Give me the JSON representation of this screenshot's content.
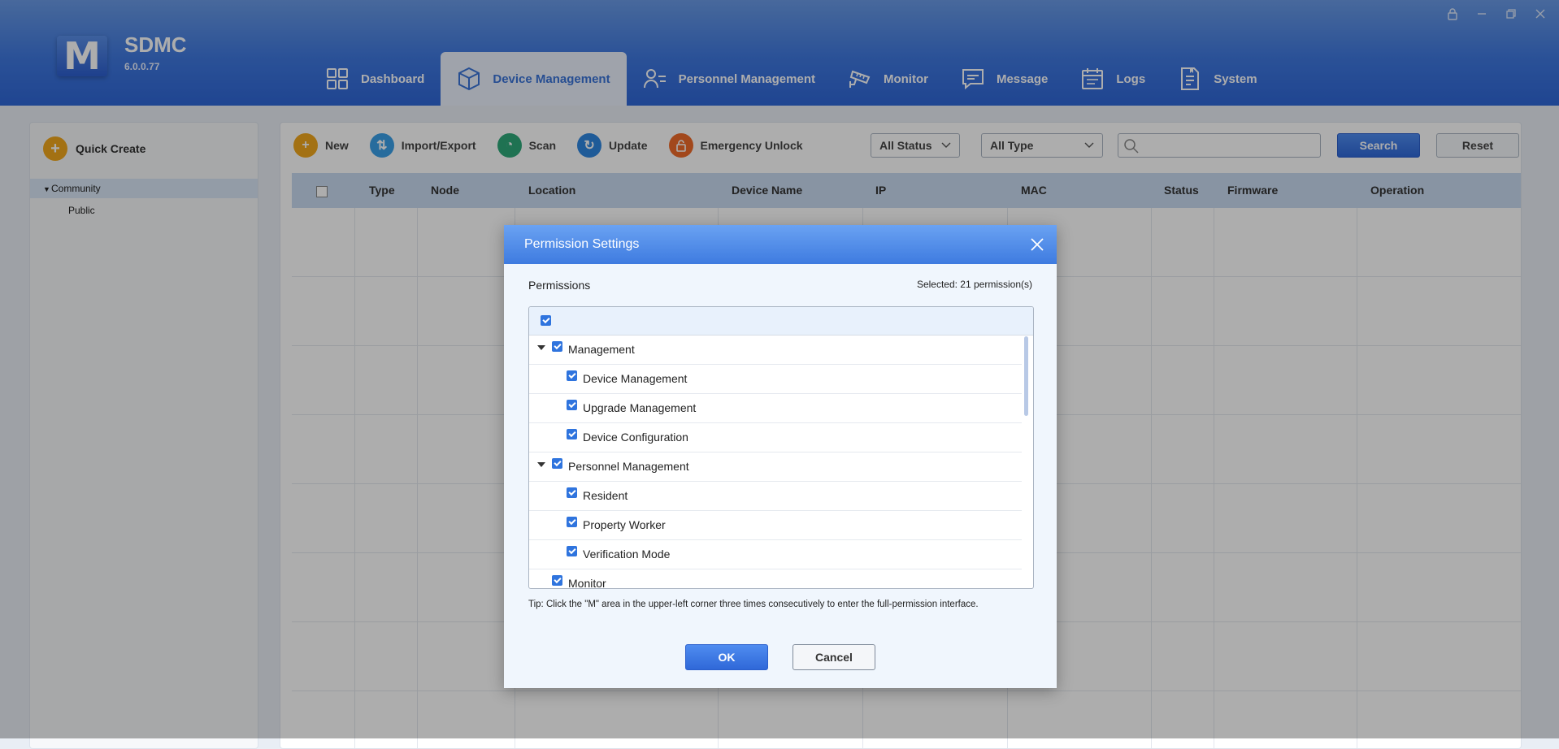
{
  "app": {
    "logo_letter": "M",
    "name": "SDMC",
    "version": "6.0.0.77"
  },
  "window_controls": [
    "lock-icon",
    "minimize-icon",
    "restore-icon",
    "close-icon"
  ],
  "nav": [
    {
      "label": "Dashboard",
      "icon": "dashboard-icon"
    },
    {
      "label": "Device Management",
      "icon": "device-box-icon",
      "active": true
    },
    {
      "label": "Personnel Management",
      "icon": "person-list-icon"
    },
    {
      "label": "Monitor",
      "icon": "camera-icon"
    },
    {
      "label": "Message",
      "icon": "message-icon"
    },
    {
      "label": "Logs",
      "icon": "calendar-icon"
    },
    {
      "label": "System",
      "icon": "document-icon"
    }
  ],
  "sidebar": {
    "quick_create": "Quick Create",
    "tree": {
      "root": "Community",
      "child": "Public"
    }
  },
  "toolbar": {
    "new": "New",
    "import_export": "Import/Export",
    "scan": "Scan",
    "update": "Update",
    "emergency_unlock": "Emergency Unlock",
    "status_select": "All Status",
    "type_select": "All Type",
    "search_placeholder": "",
    "search_button": "Search",
    "reset_button": "Reset"
  },
  "table": {
    "columns": [
      "Type",
      "Node",
      "Location",
      "Device Name",
      "IP",
      "MAC",
      "Status",
      "Firmware",
      "Operation"
    ],
    "rows": []
  },
  "modal": {
    "title": "Permission Settings",
    "permissions_label": "Permissions",
    "selected_count": "Selected: 21 permission(s)",
    "items": [
      "Management",
      "Device Management",
      "Upgrade Management",
      "Device Configuration",
      "Personnel Management",
      "Resident",
      "Property Worker",
      "Verification Mode",
      "Monitor"
    ],
    "tip": "Tip: Click the \"M\" area in the upper-left corner three times consecutively to enter the full-permission interface.",
    "ok": "OK",
    "cancel": "Cancel"
  },
  "colors": {
    "header_blue": "#3f78df",
    "accent_blue": "#2f74de",
    "new_orange": "#f0a71c",
    "import_blue": "#3aa0e8",
    "scan_green": "#2fa87a",
    "update_blue": "#2f86e0",
    "unlock_orange": "#ef6b2a"
  }
}
